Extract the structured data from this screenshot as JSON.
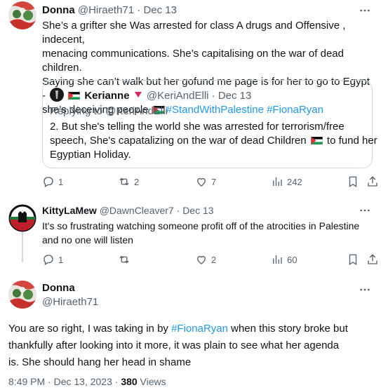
{
  "tweet1": {
    "name": "Donna",
    "handle": "@Hiraeth71",
    "sep": "·",
    "date": "Dec 13",
    "text_lines": [
      "She’s a grifter she Was arrested for class A drugs and Offensive , indecent,",
      "menacing communications. She’s capitalising on the war of dead children.",
      "Saying she can’t walk but her gofund me page is for her to go to Egypt -"
    ],
    "text_last_prefix": "she’s deceiving people ",
    "hashtag1": "#StandWithPalestine",
    "hashtag2": "#FionaRyan",
    "quote": {
      "name": "Kerianne",
      "handle": "@KeriAndElli",
      "sep": "·",
      "date": "Dec 13",
      "replying": "Replying to @KeriAndElli",
      "line1": "2. But she's telling the world she was arrested for terrorism/free",
      "line2_a": "speech, She's capatalizing on the war of dead Children ",
      "line2_b": " to fund her",
      "line3": "Egyptian Holiday."
    },
    "stats": {
      "replies": "1",
      "retweets": "2",
      "likes": "7",
      "views": "242"
    }
  },
  "tweet2": {
    "name": "KittyLaMew",
    "handle": "@DawnCleaver7",
    "sep": "·",
    "date": "Dec 13",
    "text_line1": "It's so frustrating watching someone profit off of the atrocities in Palestine",
    "text_line2": "and no one will listen",
    "stats": {
      "replies": "1",
      "retweets": "",
      "likes": "2",
      "views": "60"
    }
  },
  "main": {
    "name": "Donna",
    "handle": "@Hiraeth71",
    "text_a": "You are so right, I was taking in by ",
    "hashtag": "#FionaRyan",
    "text_b": " when this story broke but",
    "line2": "thankfully after looking into it more, it was plain to see what her agenda",
    "line3": "is. She should hang her head in shame",
    "time": "8:49 PM · Dec 13, 2023 · ",
    "views_count": "380",
    "views_label": " Views"
  },
  "colors": {
    "accent": "#1d9bf0",
    "muted": "#536471",
    "border": "#cfd9de",
    "heart": "#f4212e"
  }
}
